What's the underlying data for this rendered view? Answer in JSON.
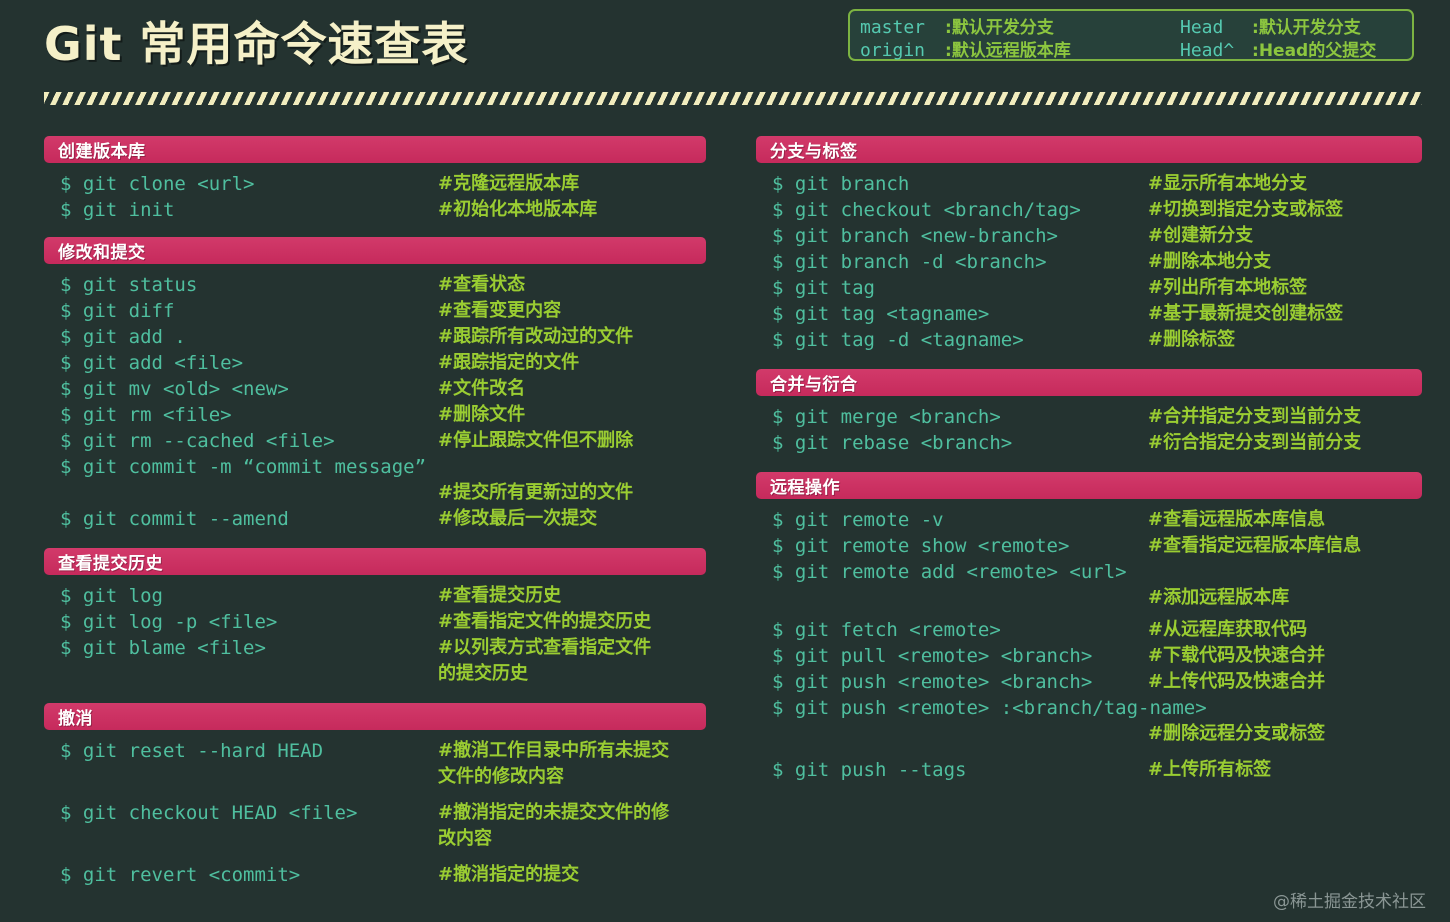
{
  "header": {
    "title": "Git 常用命令速查表",
    "legend": [
      {
        "key": "master",
        "sep": ":",
        "desc": "默认开发分支"
      },
      {
        "key": "Head",
        "sep": ":",
        "desc": "默认开发分支"
      },
      {
        "key": "origin",
        "sep": ":",
        "desc": "默认远程版本库"
      },
      {
        "key": "Head^",
        "sep": ":",
        "desc_mono": "Head",
        "desc": " 的父提交"
      }
    ]
  },
  "colors": {
    "background": "#243330",
    "section_header": "#cf3365",
    "command_text": "#4fbf9f",
    "comment_text": "#9acd32",
    "title_text": "#f5f0c8",
    "legend_border": "#7cb342",
    "legend_key": "#55c9b0",
    "watermark": "#8a9694"
  },
  "left_column": [
    {
      "heading": "创建版本库",
      "rows": [
        {
          "cmd": "$ git clone <url>",
          "note": "#克隆远程版本库"
        },
        {
          "cmd": "$ git init",
          "note": "#初始化本地版本库"
        }
      ]
    },
    {
      "heading": "修改和提交",
      "rows": [
        {
          "cmd": "$ git status",
          "note": "#查看状态"
        },
        {
          "cmd": "$ git diff",
          "note": "#查看变更内容"
        },
        {
          "cmd": "$ git add .",
          "note": "#跟踪所有改动过的文件"
        },
        {
          "cmd": "$ git add <file>",
          "note": "#跟踪指定的文件"
        },
        {
          "cmd": "$ git mv <old> <new>",
          "note": "#文件改名"
        },
        {
          "cmd": "$ git rm <file>",
          "note": "#删除文件"
        },
        {
          "cmd": "$ git rm --cached <file>",
          "note": "#停止跟踪文件但不删除"
        },
        {
          "cmd": "$ git commit -m “commit message”",
          "note": "",
          "note_below": "#提交所有更新过的文件"
        },
        {
          "cmd": "$ git commit --amend",
          "note": "#修改最后一次提交"
        }
      ]
    },
    {
      "heading": "查看提交历史",
      "rows": [
        {
          "cmd": "$ git log",
          "note": "#查看提交历史"
        },
        {
          "cmd": "$ git log -p <file>",
          "note": "#查看指定文件的提交历史"
        },
        {
          "cmd": "$ git blame <file>",
          "note": "#以列表方式查看指定文件\n的提交历史"
        }
      ]
    },
    {
      "heading": "撤消",
      "rows": [
        {
          "cmd": "$ git reset --hard HEAD",
          "note": "#撤消工作目录中所有未提交\n文件的修改内容"
        },
        {
          "cmd": "$ git checkout HEAD <file>",
          "note": "#撤消指定的未提交文件的修\n改内容"
        },
        {
          "cmd": "$ git revert <commit>",
          "note": "#撤消指定的提交"
        }
      ]
    }
  ],
  "right_column": [
    {
      "heading": "分支与标签",
      "rows": [
        {
          "cmd": "$ git branch",
          "note": "#显示所有本地分支"
        },
        {
          "cmd": "$ git checkout <branch/tag>",
          "note": "#切换到指定分支或标签"
        },
        {
          "cmd": "$ git branch <new-branch>",
          "note": "#创建新分支"
        },
        {
          "cmd": "$ git branch -d <branch>",
          "note": "#删除本地分支"
        },
        {
          "cmd": "$ git tag",
          "note": "#列出所有本地标签"
        },
        {
          "cmd": "$ git tag <tagname>",
          "note": "#基于最新提交创建标签"
        },
        {
          "cmd": "$ git tag -d <tagname>",
          "note": "#删除标签"
        }
      ]
    },
    {
      "heading": "合并与衍合",
      "rows": [
        {
          "cmd": "$ git merge <branch>",
          "note": "#合并指定分支到当前分支"
        },
        {
          "cmd": "$ git rebase <branch>",
          "note": "#衍合指定分支到当前分支"
        }
      ]
    },
    {
      "heading": "远程操作",
      "rows": [
        {
          "cmd": "$ git remote -v",
          "note": "#查看远程版本库信息"
        },
        {
          "cmd": "$ git remote show <remote>",
          "note": "#查看指定远程版本库信息"
        },
        {
          "cmd": "$ git remote add <remote> <url>",
          "note": "",
          "note_below": "#添加远程版本库"
        },
        {
          "cmd": "$ git fetch <remote>",
          "note": "#从远程库获取代码"
        },
        {
          "cmd": "$ git pull <remote> <branch>",
          "note": "#下载代码及快速合并"
        },
        {
          "cmd": "$ git push <remote> <branch>",
          "note": "#上传代码及快速合并"
        },
        {
          "cmd": "$ git push <remote> :<branch/tag-name>",
          "note": "",
          "note_below": "#删除远程分支或标签"
        },
        {
          "cmd": "$ git push --tags",
          "note": "#上传所有标签"
        }
      ]
    }
  ],
  "watermark": "@稀土掘金技术社区"
}
